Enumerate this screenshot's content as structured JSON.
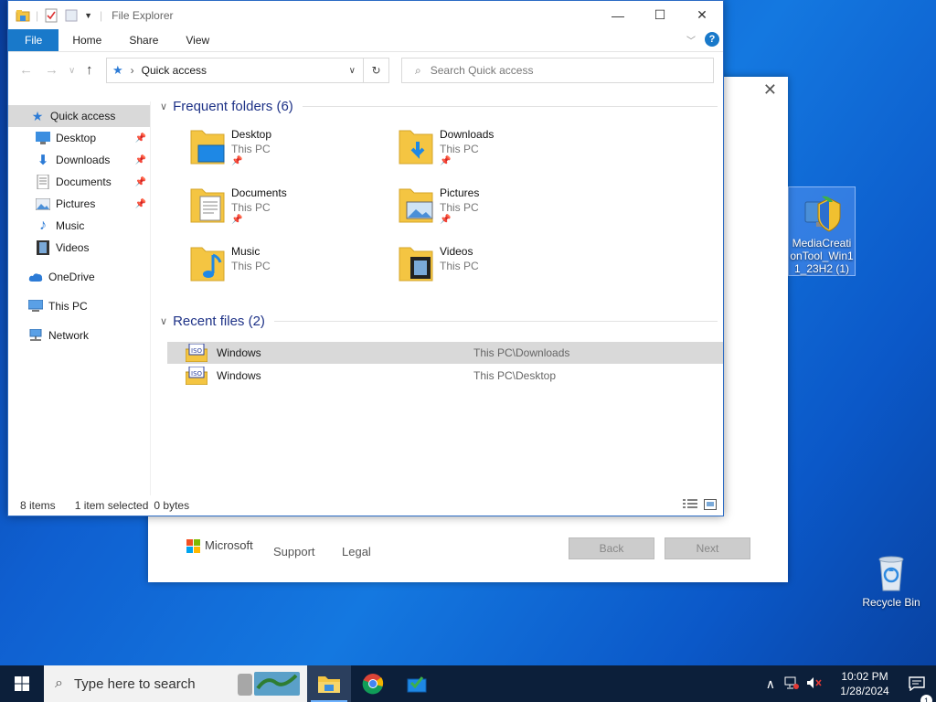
{
  "explorer": {
    "title": "File Explorer",
    "tabs": [
      "File",
      "Home",
      "Share",
      "View"
    ],
    "address": "Quick access",
    "search_placeholder": "Search Quick access",
    "sidebar": [
      {
        "label": "Quick access",
        "icon": "star-icon",
        "pinned": false
      },
      {
        "label": "Desktop",
        "icon": "desktop-icon",
        "pinned": true
      },
      {
        "label": "Downloads",
        "icon": "download-icon",
        "pinned": true
      },
      {
        "label": "Documents",
        "icon": "documents-icon",
        "pinned": true
      },
      {
        "label": "Pictures",
        "icon": "pictures-icon",
        "pinned": true
      },
      {
        "label": "Music",
        "icon": "music-icon",
        "pinned": false
      },
      {
        "label": "Videos",
        "icon": "videos-icon",
        "pinned": false
      },
      {
        "label": "OneDrive",
        "icon": "cloud-icon",
        "pinned": false
      },
      {
        "label": "This PC",
        "icon": "pc-icon",
        "pinned": false
      },
      {
        "label": "Network",
        "icon": "network-icon",
        "pinned": false
      }
    ],
    "frequent_header": "Frequent folders (6)",
    "folders": [
      {
        "name": "Desktop",
        "location": "This PC",
        "pinned": true
      },
      {
        "name": "Downloads",
        "location": "This PC",
        "pinned": true
      },
      {
        "name": "Documents",
        "location": "This PC",
        "pinned": true
      },
      {
        "name": "Pictures",
        "location": "This PC",
        "pinned": true
      },
      {
        "name": "Music",
        "location": "This PC",
        "pinned": false
      },
      {
        "name": "Videos",
        "location": "This PC",
        "pinned": false
      }
    ],
    "recent_header": "Recent files (2)",
    "recent_files": [
      {
        "name": "Windows",
        "location": "This PC\\Downloads",
        "selected": true
      },
      {
        "name": "Windows",
        "location": "This PC\\Desktop",
        "selected": false
      }
    ],
    "status": {
      "items": "8 items",
      "selection": "1 item selected",
      "size": "0 bytes"
    }
  },
  "setup": {
    "brand": "Microsoft",
    "support": "Support",
    "legal": "Legal",
    "back": "Back",
    "next": "Next"
  },
  "desktop": {
    "media_tool": "MediaCreationTool_Win11_23H2 (1)",
    "recycle_bin": "Recycle Bin"
  },
  "taskbar": {
    "search_placeholder": "Type here to search",
    "time": "10:02 PM",
    "date": "1/28/2024",
    "notifications": "1"
  },
  "colors": {
    "accent": "#1979ca",
    "folder": "#f4c542",
    "taskbar": "#0c1f3a"
  }
}
